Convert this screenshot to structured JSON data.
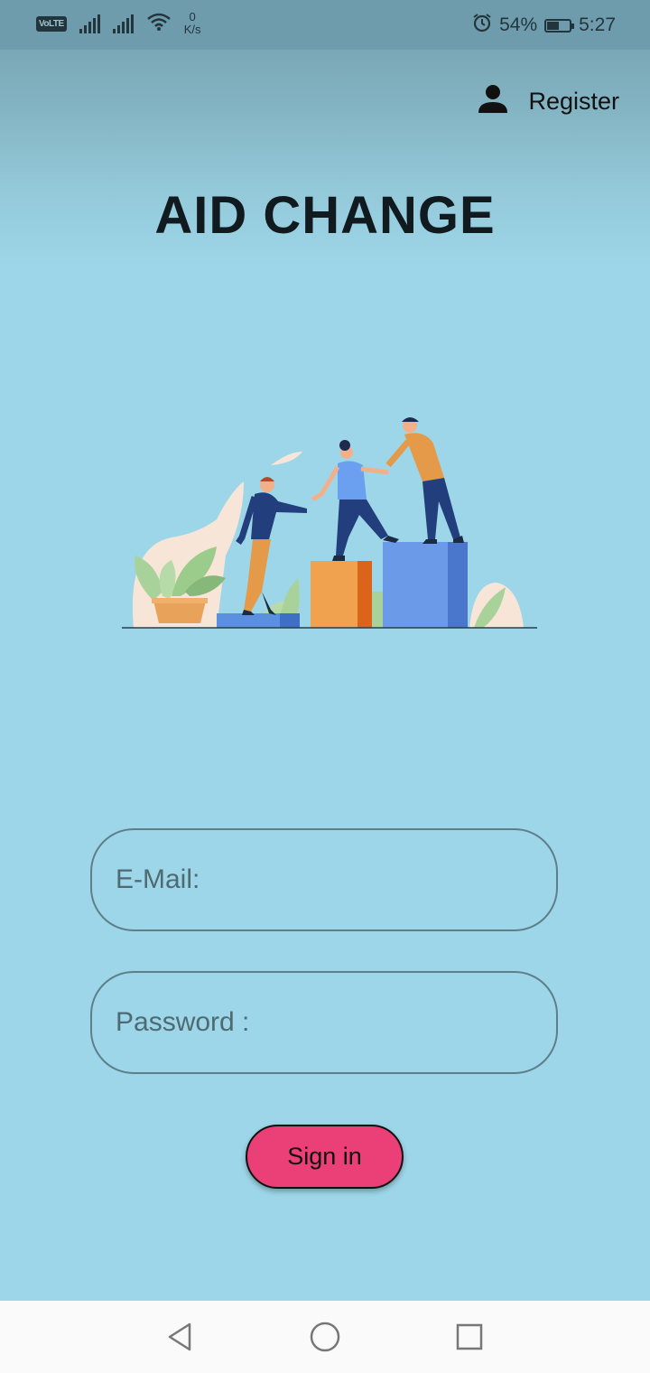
{
  "status_bar": {
    "volte": "VoLTE",
    "speed_value": "0",
    "speed_unit": "K/s",
    "battery_percent": "54%",
    "battery_level": 0.54,
    "time": "5:27",
    "icons": [
      "signal-icon",
      "signal-icon",
      "wifi-icon",
      "alarm-icon",
      "battery-icon"
    ]
  },
  "header": {
    "register_label": "Register",
    "register_icon": "person-icon"
  },
  "app": {
    "title": "AID CHANGE"
  },
  "form": {
    "email_placeholder": "E-Mail:",
    "password_placeholder": "Password :",
    "signin_label": "Sign in"
  },
  "nav": {
    "icons": [
      "back-icon",
      "home-icon",
      "recents-icon"
    ]
  },
  "colors": {
    "background": "#9dd6e8",
    "accent": "#ea3f77"
  }
}
